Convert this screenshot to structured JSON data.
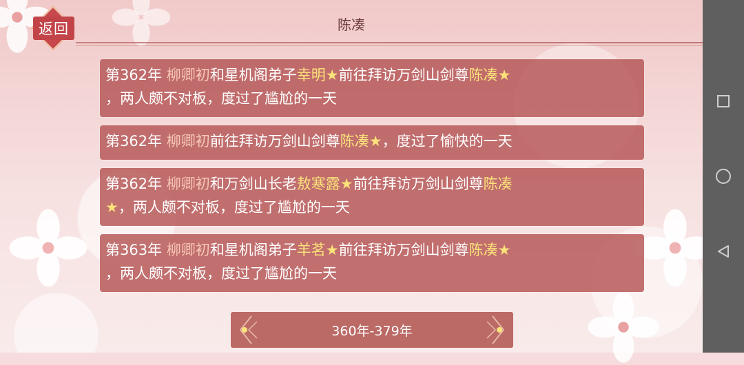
{
  "header": {
    "back_label": "返回",
    "title": "陈凑"
  },
  "events": [
    {
      "segments": [
        {
          "text": "第362年 ",
          "style": "plain"
        },
        {
          "text": "柳卿初",
          "style": "pink"
        },
        {
          "text": "和星机阁弟子",
          "style": "plain"
        },
        {
          "text": "幸明★",
          "style": "gold"
        },
        {
          "text": "前往拜访万剑山剑尊",
          "style": "plain"
        },
        {
          "text": "陈凑★",
          "style": "gold"
        },
        {
          "text": "\n，两人颇不对板，度过了尴尬的一天",
          "style": "plain"
        }
      ]
    },
    {
      "segments": [
        {
          "text": "第362年 ",
          "style": "plain"
        },
        {
          "text": "柳卿初",
          "style": "pink"
        },
        {
          "text": "前往拜访万剑山剑尊",
          "style": "plain"
        },
        {
          "text": "陈凑★",
          "style": "gold"
        },
        {
          "text": "，度过了愉快的一天",
          "style": "plain"
        }
      ]
    },
    {
      "segments": [
        {
          "text": "第362年 ",
          "style": "plain"
        },
        {
          "text": "柳卿初",
          "style": "pink"
        },
        {
          "text": "和万剑山长老",
          "style": "plain"
        },
        {
          "text": "敖寒露★",
          "style": "gold"
        },
        {
          "text": "前往拜访万剑山剑尊",
          "style": "plain"
        },
        {
          "text": "陈凑\n★",
          "style": "gold"
        },
        {
          "text": "，两人颇不对板，度过了尴尬的一天",
          "style": "plain"
        }
      ]
    },
    {
      "segments": [
        {
          "text": "第363年 ",
          "style": "plain"
        },
        {
          "text": "柳卿初",
          "style": "pink"
        },
        {
          "text": "和星机阁弟子",
          "style": "plain"
        },
        {
          "text": "羊茗★",
          "style": "gold"
        },
        {
          "text": "前往拜访万剑山剑尊",
          "style": "plain"
        },
        {
          "text": "陈凑★",
          "style": "gold"
        },
        {
          "text": "\n，两人颇不对板，度过了尴尬的一天",
          "style": "plain"
        }
      ]
    }
  ],
  "period_selector": {
    "label": "360年-379年"
  },
  "icons": {
    "back": "diamond-badge",
    "prev": "chevron-left-icon",
    "next": "chevron-right-icon",
    "nav_recent": "square-icon",
    "nav_home": "circle-icon",
    "nav_back": "triangle-back-icon"
  },
  "colors": {
    "card": "#b45454",
    "name_pink": "#f6c6b8",
    "name_gold": "#fbe27a",
    "accent": "#c7474c"
  }
}
